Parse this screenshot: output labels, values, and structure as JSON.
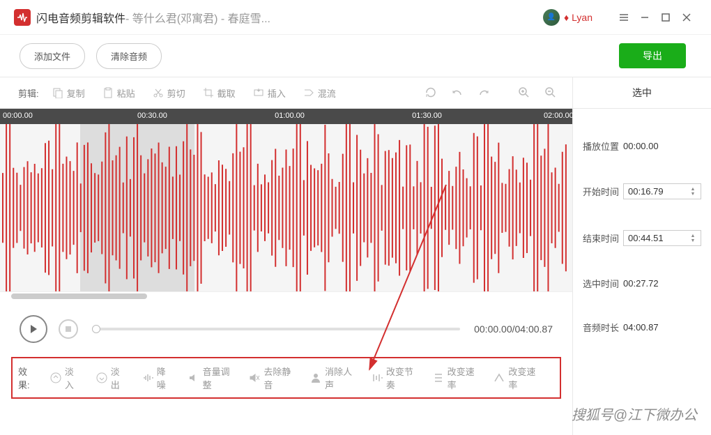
{
  "titlebar": {
    "app_name": "闪电音频剪辑软件",
    "file_name": " - 等什么君(邓寓君) - 春庭雪...",
    "username": "Lyan"
  },
  "topbar": {
    "add_file": "添加文件",
    "clear_audio": "清除音频",
    "export": "导出"
  },
  "toolbar": {
    "label": "剪辑:",
    "copy": "复制",
    "paste": "粘贴",
    "cut": "剪切",
    "crop": "截取",
    "insert": "插入",
    "mix": "混流"
  },
  "ruler": {
    "ticks": [
      "00:00.00",
      "00:30.00",
      "01:00.00",
      "01:30.00",
      "02:00.00"
    ]
  },
  "playback": {
    "time": "00:00.00/04:00.87"
  },
  "effects": {
    "label": "效果:",
    "fade_in": "淡入",
    "fade_out": "淡出",
    "denoise": "降噪",
    "volume": "音量调整",
    "desilence": "去除静音",
    "devocal": "消除人声",
    "tempo": "改变节奏",
    "speed": "改变速率",
    "pitch": "改变速率"
  },
  "right": {
    "header": "选中",
    "play_pos_label": "播放位置",
    "play_pos": "00:00.00",
    "start_label": "开始时间",
    "start": "00:16.79",
    "end_label": "结束时间",
    "end": "00:44.51",
    "sel_label": "选中时间",
    "sel": "00:27.72",
    "dur_label": "音频时长",
    "dur": "04:00.87"
  },
  "watermark": "搜狐号@江下微办公"
}
